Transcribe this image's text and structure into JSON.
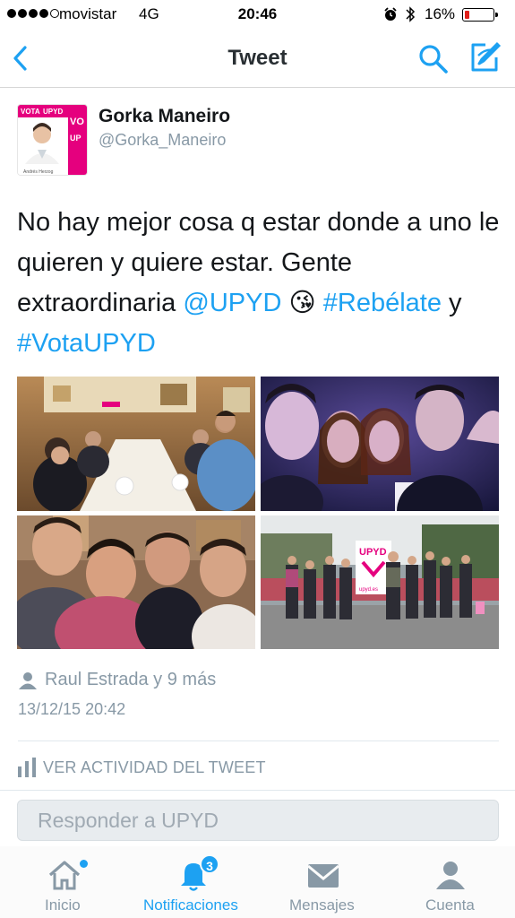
{
  "status_bar": {
    "carrier": "movistar",
    "network": "4G",
    "time": "20:46",
    "battery_percent": "16%",
    "battery_level": 0.16,
    "battery_color": "#e0201b"
  },
  "nav": {
    "title": "Tweet",
    "left_icon": "back-chevron-icon",
    "right_icons": [
      "search-icon",
      "compose-icon"
    ]
  },
  "tweet": {
    "author_name": "Gorka Maneiro",
    "author_handle": "@Gorka_Maneiro",
    "avatar_text": {
      "vota": "VOTA",
      "brand": "UPYD",
      "caption": "Andrés Herzog"
    },
    "text_parts": {
      "p1": "No hay mejor cosa q estar donde a uno le quieren y quiere estar. Gente extraordinaria ",
      "mention": "@UPYD",
      "emoji": "😘",
      "hashtag1": "#Rebélate",
      "conj": " y ",
      "hashtag2": "#VotaUPYD"
    },
    "photos": {
      "p4_banner": "UPYD",
      "p4_url": "upyd.es"
    },
    "favorited_by": "Raul Estrada y 9 más",
    "date": "13/12/15 20:42",
    "activity_label": "VER ACTIVIDAD DEL TWEET"
  },
  "reply": {
    "placeholder": "Responder a UPYD"
  },
  "tab_bar": {
    "tabs": [
      {
        "label": "Inicio",
        "icon": "home-icon"
      },
      {
        "label": "Notificaciones",
        "icon": "bell-icon",
        "badge": "3",
        "active": true
      },
      {
        "label": "Mensajes",
        "icon": "envelope-icon"
      },
      {
        "label": "Cuenta",
        "icon": "person-icon"
      }
    ]
  },
  "colors": {
    "accent": "#1da1f2",
    "text": "#14171a",
    "muted": "#8899a6",
    "brand_pink": "#e5007e"
  }
}
